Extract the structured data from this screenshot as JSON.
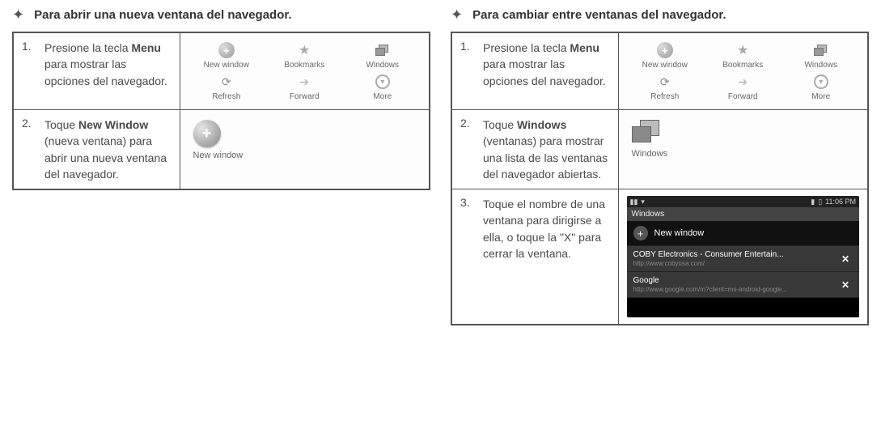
{
  "left": {
    "heading": "Para abrir una nueva ventana del navegador.",
    "steps": {
      "s1": {
        "num": "1.",
        "t1": "Presione la tecla ",
        "b1": "Menu",
        "t2": " para mostrar las opciones del navegador."
      },
      "s2": {
        "num": "2.",
        "t1": "Toque ",
        "b1": "New Window",
        "t2": " (nueva ventana) para abrir una nueva ventana del navegador."
      }
    },
    "menu": {
      "new_window": "New window",
      "bookmarks": "Bookmarks",
      "windows": "Windows",
      "refresh": "Refresh",
      "forward": "Forward",
      "more": "More"
    },
    "large_label": "New window"
  },
  "right": {
    "heading": "Para cambiar entre ventanas del navegador.",
    "steps": {
      "s1": {
        "num": "1.",
        "t1": "Presione la tecla ",
        "b1": "Menu",
        "t2": " para mostrar las opciones del navegador."
      },
      "s2": {
        "num": "2.",
        "t1": "Toque ",
        "b1": "Windows",
        "t2": " (ventanas) para mostrar una lista de las ventanas del navegador abiertas."
      },
      "s3": {
        "num": "3.",
        "text": "Toque el nombre de una ventana para dirigirse a ella, o toque la \"X\" para cerrar la ventana."
      }
    },
    "menu": {
      "new_window": "New window",
      "bookmarks": "Bookmarks",
      "windows": "Windows",
      "refresh": "Refresh",
      "forward": "Forward",
      "more": "More"
    },
    "large_label": "Windows",
    "phone": {
      "time": "11:06 PM",
      "windows_title": "Windows",
      "new_window": "New window",
      "rows": {
        "r1": {
          "title": "COBY Electronics - Consumer Entertain...",
          "url": "http://www.cobyusa.com/"
        },
        "r2": {
          "title": "Google",
          "url": "http://www.google.com/m?client=ms-android-google..."
        }
      }
    }
  }
}
